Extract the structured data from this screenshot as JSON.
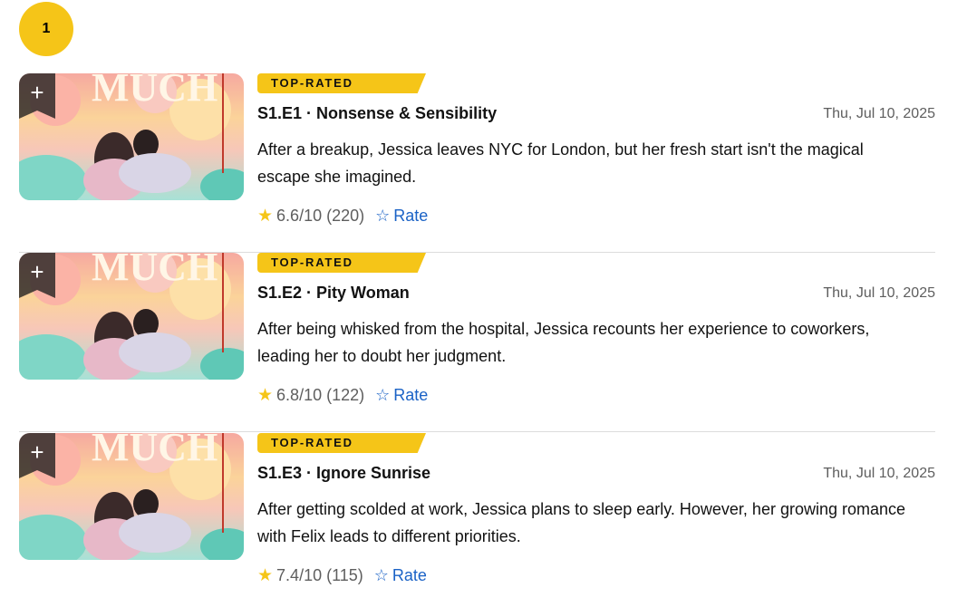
{
  "season": {
    "number": "1"
  },
  "episodes": [
    {
      "tag": "TOP-RATED",
      "title": "S1.E1 · Nonsense & Sensibility",
      "date": "Thu, Jul 10, 2025",
      "description": "After a breakup, Jessica leaves NYC for London, but her fresh start isn't the magical escape she imagined.",
      "rating": "6.6/10",
      "votes": "(220)",
      "rate_label": "Rate",
      "thumb_text": "MUCH"
    },
    {
      "tag": "TOP-RATED",
      "title": "S1.E2 · Pity Woman",
      "date": "Thu, Jul 10, 2025",
      "description": "After being whisked from the hospital, Jessica recounts her experience to coworkers, leading her to doubt her judgment.",
      "rating": "6.8/10",
      "votes": "(122)",
      "rate_label": "Rate",
      "thumb_text": "MUCH"
    },
    {
      "tag": "TOP-RATED",
      "title": "S1.E3 · Ignore Sunrise",
      "date": "Thu, Jul 10, 2025",
      "description": "After getting scolded at work, Jessica plans to sleep early. However, her growing romance with Felix leads to different priorities.",
      "rating": "7.4/10",
      "votes": "(115)",
      "rate_label": "Rate",
      "thumb_text": "MUCH"
    }
  ],
  "icons": {
    "add": "plus-icon",
    "star": "star-filled-icon",
    "rate": "star-outline-icon"
  },
  "colors": {
    "accent": "#f5c518",
    "link": "#1a62c6",
    "muted": "#5e5e5e"
  }
}
